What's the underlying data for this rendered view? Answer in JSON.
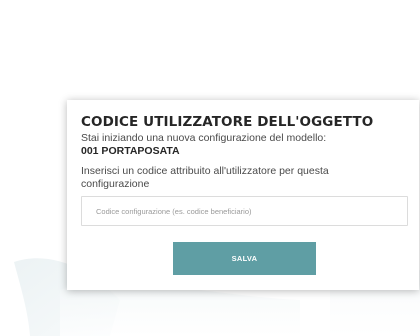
{
  "dialog": {
    "title": "CODICE UTILIZZATORE DELL'OGGETTO",
    "subtitle": "Stai iniziando una nuova configurazione del modello:",
    "model": "001 PORTAPOSATA",
    "instruction": "Inserisci un codice attribuito all'utilizzatore per questa configurazione",
    "input": {
      "placeholder": "Codice configurazione (es. codice beneficiario)",
      "value": ""
    },
    "save_label": "SALVA"
  },
  "colors": {
    "accent": "#5f9ea4",
    "backdrop": "#ffffff"
  }
}
